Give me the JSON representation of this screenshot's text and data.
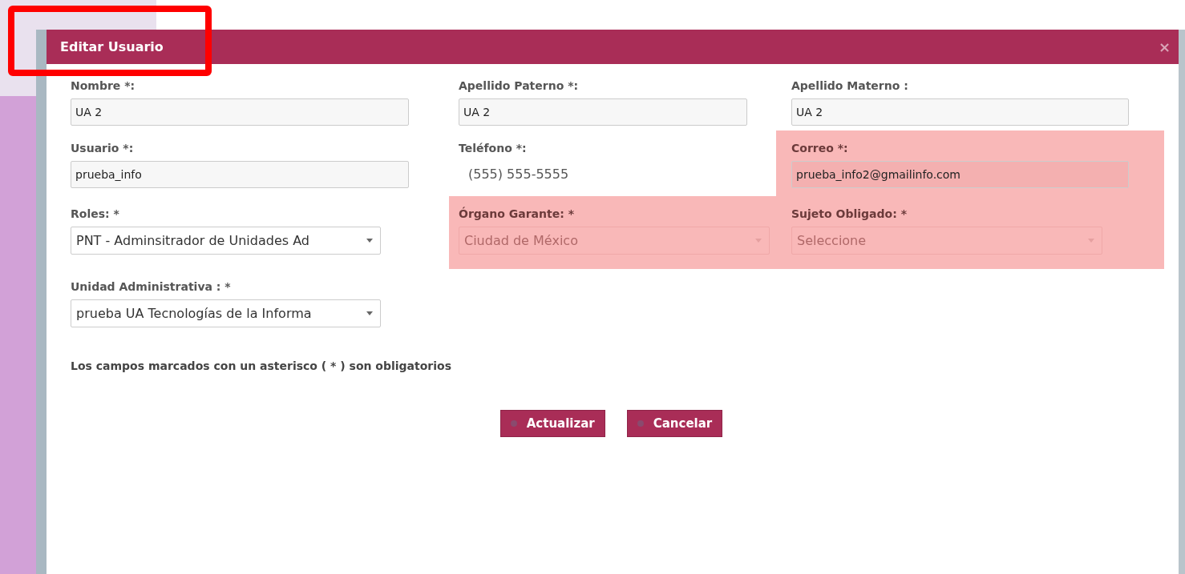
{
  "dialog": {
    "title": "Editar Usuario",
    "close": "×"
  },
  "fields": [
    {
      "label": "Nombre *:",
      "kind": "input",
      "value": "UA 2",
      "highlighted": false
    },
    {
      "label": "Apellido Paterno *:",
      "kind": "input",
      "value": "UA 2",
      "highlighted": false
    },
    {
      "label": "Apellido Materno :",
      "kind": "input",
      "value": "UA 2",
      "highlighted": false
    },
    {
      "label": "Usuario *:",
      "kind": "input",
      "value": "prueba_info",
      "highlighted": false
    },
    {
      "label": "Teléfono *:",
      "kind": "text",
      "value": "(555) 555-5555",
      "highlighted": false
    },
    {
      "label": "Correo *:",
      "kind": "input",
      "value": "prueba_info2@gmailinfo.com",
      "highlighted": true
    },
    {
      "label": "Roles: *",
      "kind": "select",
      "value": "PNT - Adminsitrador de Unidades Ad",
      "disabled": false,
      "highlighted": false
    },
    {
      "label": "Órgano Garante: *",
      "kind": "select",
      "value": "Ciudad de México",
      "disabled": true,
      "highlighted": true
    },
    {
      "label": "Sujeto Obligado: *",
      "kind": "select",
      "value": "Seleccione",
      "disabled": true,
      "highlighted": true
    },
    {
      "label": "Unidad Administrativa : *",
      "kind": "select",
      "value": "prueba UA Tecnologías de la Informa",
      "disabled": false,
      "highlighted": false
    }
  ],
  "note": "Los campos marcados con un asterisco ( * ) son obligatorios",
  "buttons": [
    "Actualizar",
    "Cancelar"
  ]
}
